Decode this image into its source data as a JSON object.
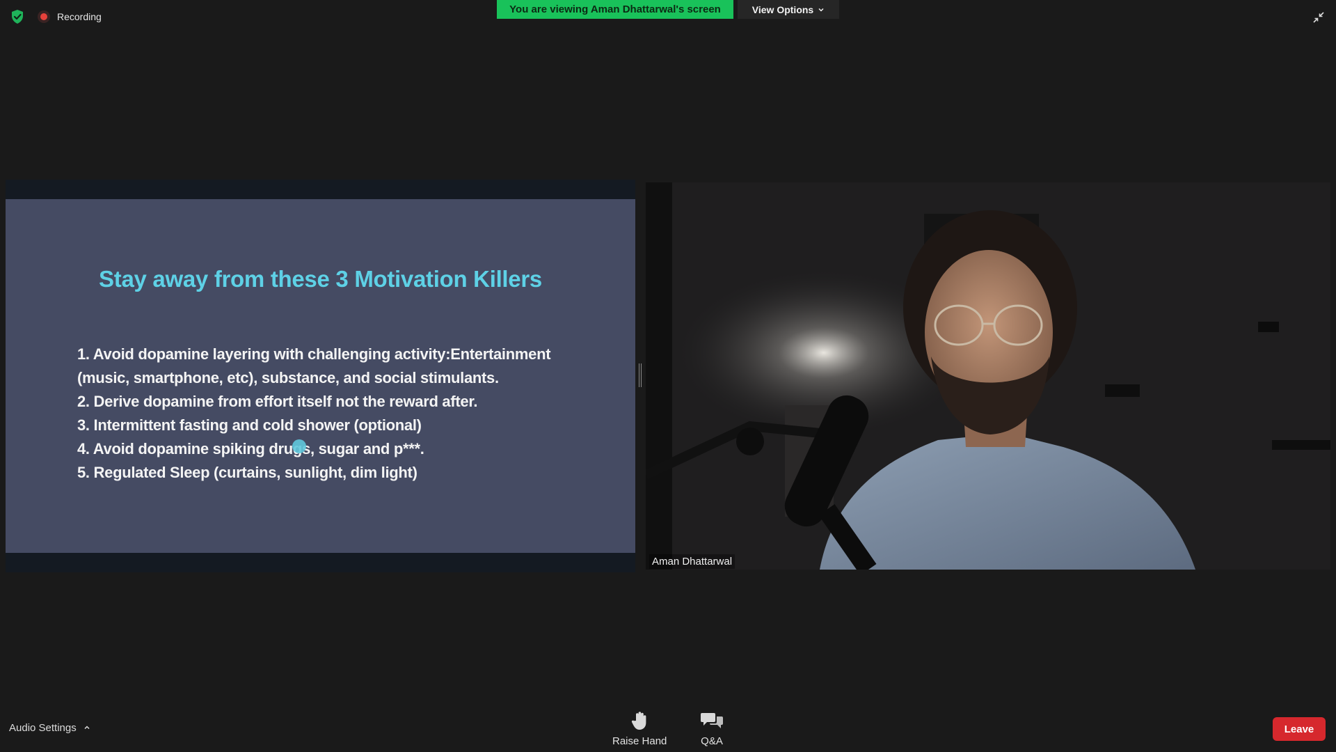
{
  "recording": {
    "label": "Recording"
  },
  "banner": {
    "viewing_text": "You are viewing Aman Dhattarwal's screen",
    "view_options_label": "View Options"
  },
  "slide": {
    "title": "Stay away from these 3 Motivation Killers",
    "lines": [
      "1. Avoid dopamine layering with challenging activity:Entertainment",
      "(music, smartphone, etc), substance, and social stimulants.",
      "2. Derive dopamine from effort itself not the reward after.",
      "3. Intermittent fasting and cold shower (optional)",
      "4. Avoid dopamine spiking drugs, sugar and p***.",
      "5. Regulated Sleep (curtains, sunlight, dim light)"
    ]
  },
  "video": {
    "participant_name": "Aman Dhattarwal"
  },
  "controls": {
    "audio_settings_label": "Audio Settings",
    "raise_hand_label": "Raise Hand",
    "qa_label": "Q&A",
    "leave_label": "Leave"
  },
  "colors": {
    "banner_green": "#19c25a",
    "slide_bg": "#454b63",
    "slide_title": "#5ed1e6",
    "leave_red": "#d6282d"
  },
  "icons": {
    "security": "shield-check-icon",
    "recording": "record-dot-icon",
    "exit_fullscreen": "exit-fullscreen-icon",
    "raise_hand": "hand-icon",
    "qa": "speech-bubbles-icon",
    "audio_settings_caret": "chevron-up-icon",
    "view_options_caret": "chevron-down-icon"
  }
}
